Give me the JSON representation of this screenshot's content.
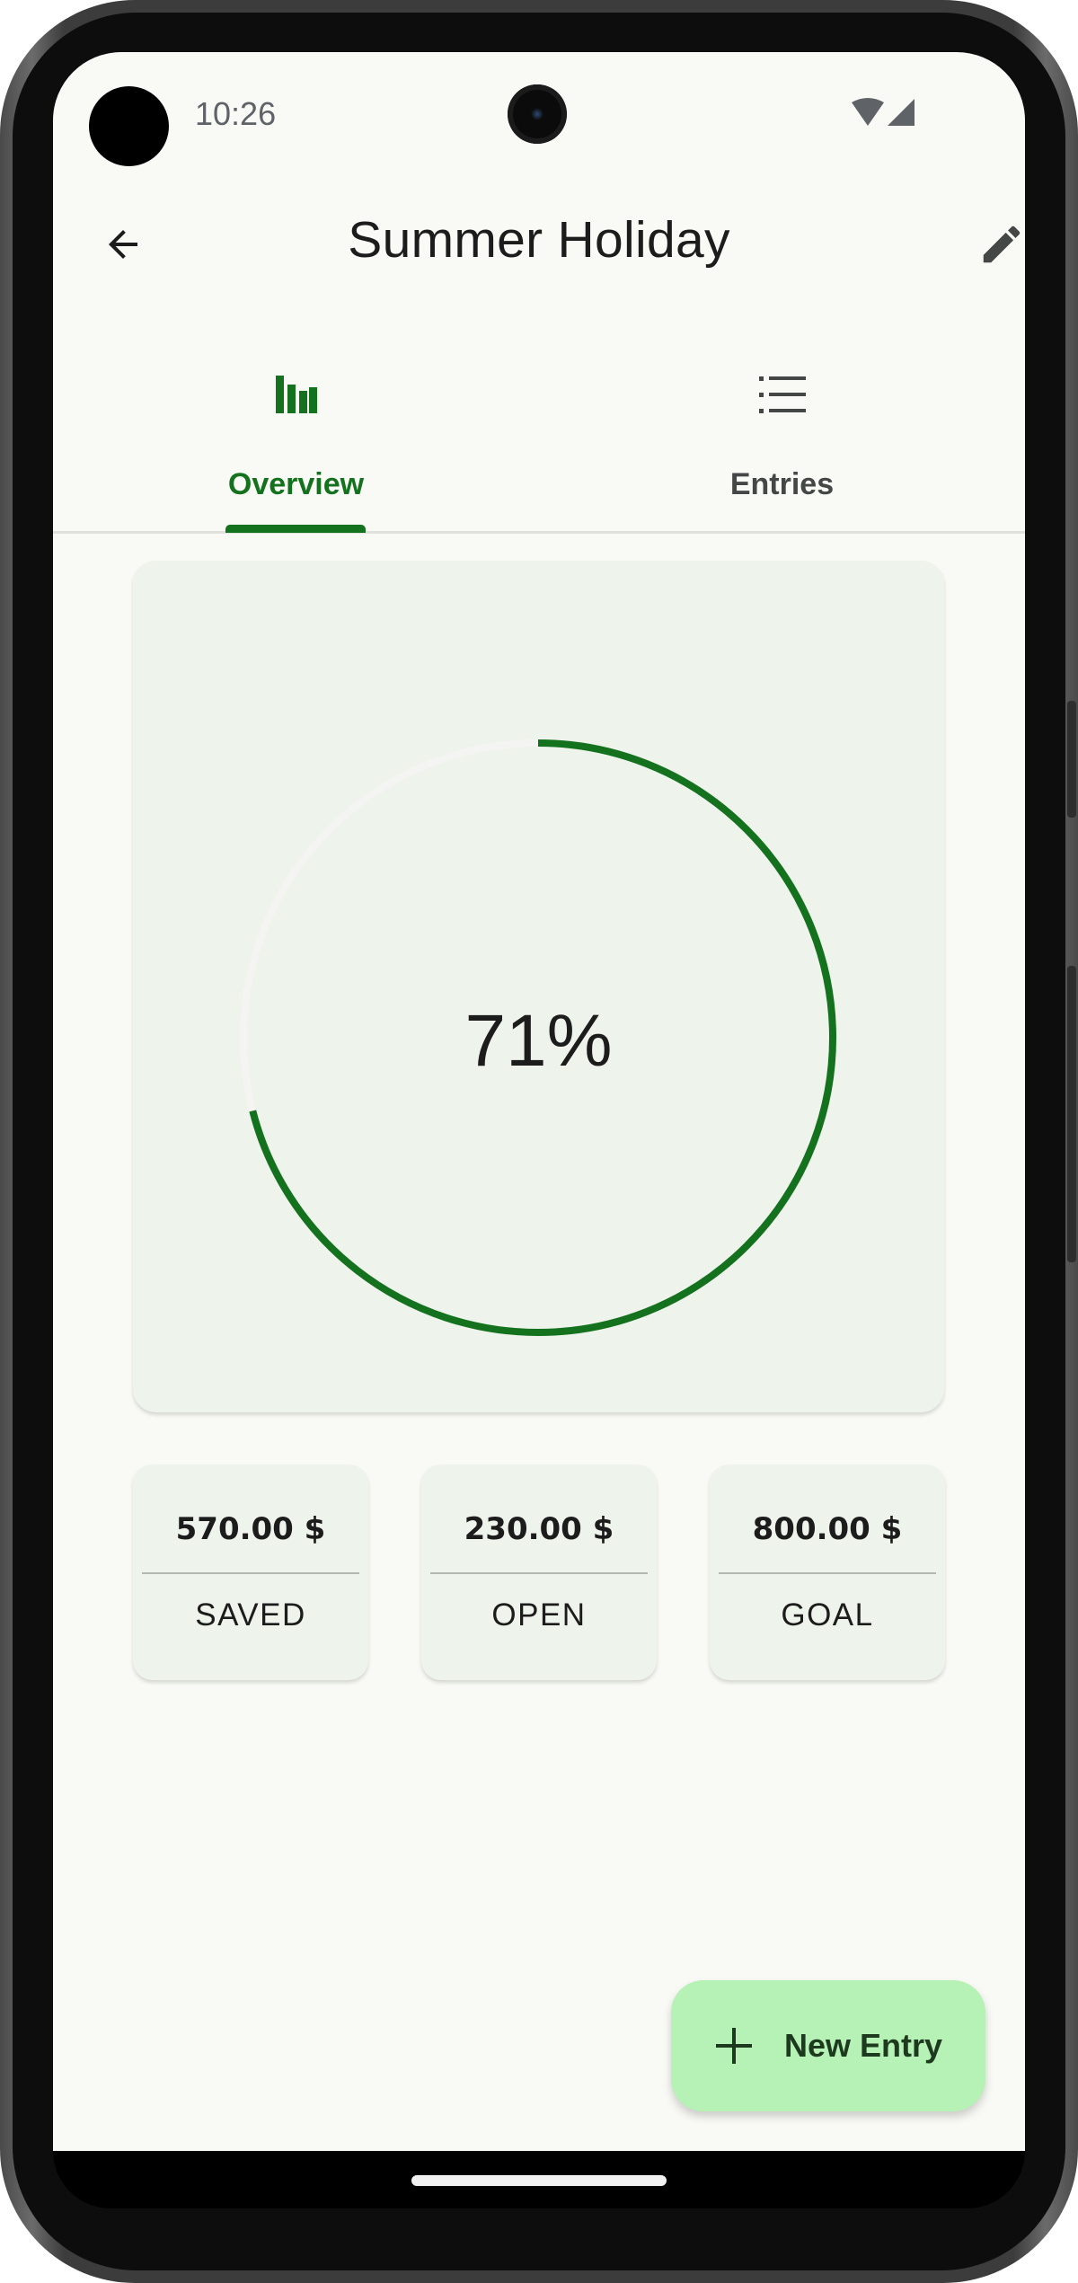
{
  "status_bar": {
    "time": "10:26",
    "icons": [
      "wifi-icon",
      "signal-icon"
    ]
  },
  "app_bar": {
    "title": "Summer Holiday",
    "back_icon": "arrow-back-icon",
    "edit_icon": "pencil-icon"
  },
  "tabs": [
    {
      "label": "Overview",
      "icon": "bar-chart-icon",
      "active": true
    },
    {
      "label": "Entries",
      "icon": "list-icon",
      "active": false
    }
  ],
  "progress": {
    "percent_text": "71%",
    "fraction": 0.71,
    "color": "#14721f",
    "track_color": "#f4f4f2"
  },
  "stats": [
    {
      "value": "570.00 $",
      "label": "SAVED"
    },
    {
      "value": "230.00 $",
      "label": "OPEN"
    },
    {
      "value": "800.00 $",
      "label": "GOAL"
    }
  ],
  "fab": {
    "label": "New Entry",
    "icon": "plus-icon",
    "color": "#b6f1b5"
  }
}
